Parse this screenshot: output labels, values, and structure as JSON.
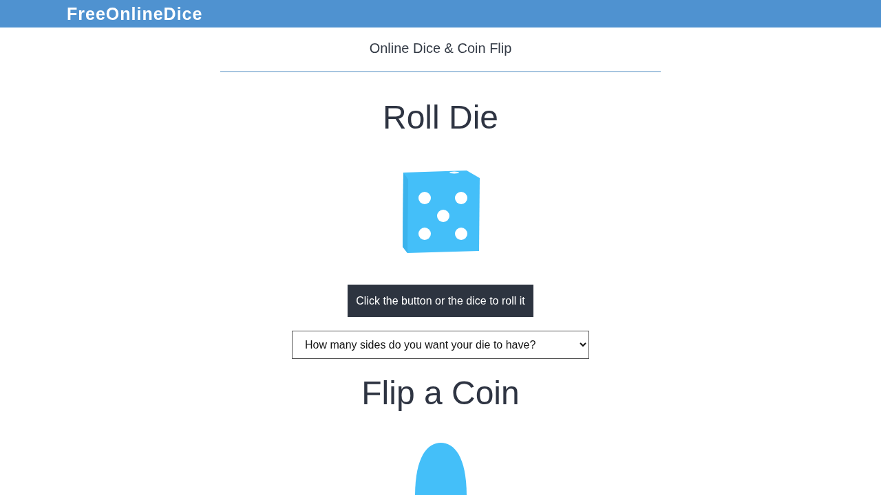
{
  "header": {
    "brand": "FreeOnlineDice"
  },
  "subtitle": "Online Dice & Coin Flip",
  "die_section": {
    "heading": "Roll Die",
    "roll_button": "Click the button or the dice to roll it",
    "sides_select": {
      "value": "How many sides do you want your die to have?"
    }
  },
  "coin_section": {
    "heading": "Flip a Coin"
  }
}
